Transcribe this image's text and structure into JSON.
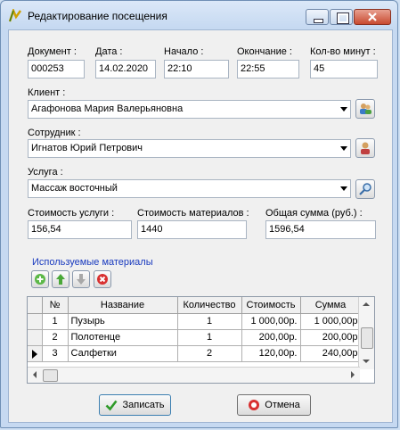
{
  "window": {
    "title": "Редактирование посещения"
  },
  "fields": {
    "document": {
      "label": "Документ :",
      "value": "000253"
    },
    "date": {
      "label": "Дата :",
      "value": "14.02.2020"
    },
    "start": {
      "label": "Начало :",
      "value": "22:10"
    },
    "end": {
      "label": "Окончание :",
      "value": "22:55"
    },
    "minutes": {
      "label": "Кол-во минут :",
      "value": "45"
    },
    "client": {
      "label": "Клиент :",
      "value": "Агафонова Мария  Валерьяновна"
    },
    "employee": {
      "label": "Сотрудник :",
      "value": "Игнатов Юрий  Петрович"
    },
    "service": {
      "label": "Услуга :",
      "value": "Массаж восточный"
    },
    "service_cost": {
      "label": "Стоимость услуги :",
      "value": "156,54"
    },
    "materials_cost": {
      "label": "Стоимость материалов :",
      "value": "1440"
    },
    "total": {
      "label": "Общая сумма (руб.) :",
      "value": "1596,54"
    }
  },
  "materials": {
    "title": "Используемые материалы",
    "columns": [
      "№",
      "Название",
      "Количество",
      "Стоимость",
      "Сумма"
    ],
    "rows": [
      [
        "1",
        "Пузырь",
        "1",
        "1 000,00р.",
        "1 000,00р"
      ],
      [
        "2",
        "Полотенце",
        "1",
        "200,00р.",
        "200,00р"
      ],
      [
        "3",
        "Салфетки",
        "2",
        "120,00р.",
        "240,00р"
      ]
    ]
  },
  "buttons": {
    "save": "Записать",
    "cancel": "Отмена"
  },
  "colors": {
    "section": "#1a3bbf",
    "titlebar": "#c6d9f1"
  }
}
